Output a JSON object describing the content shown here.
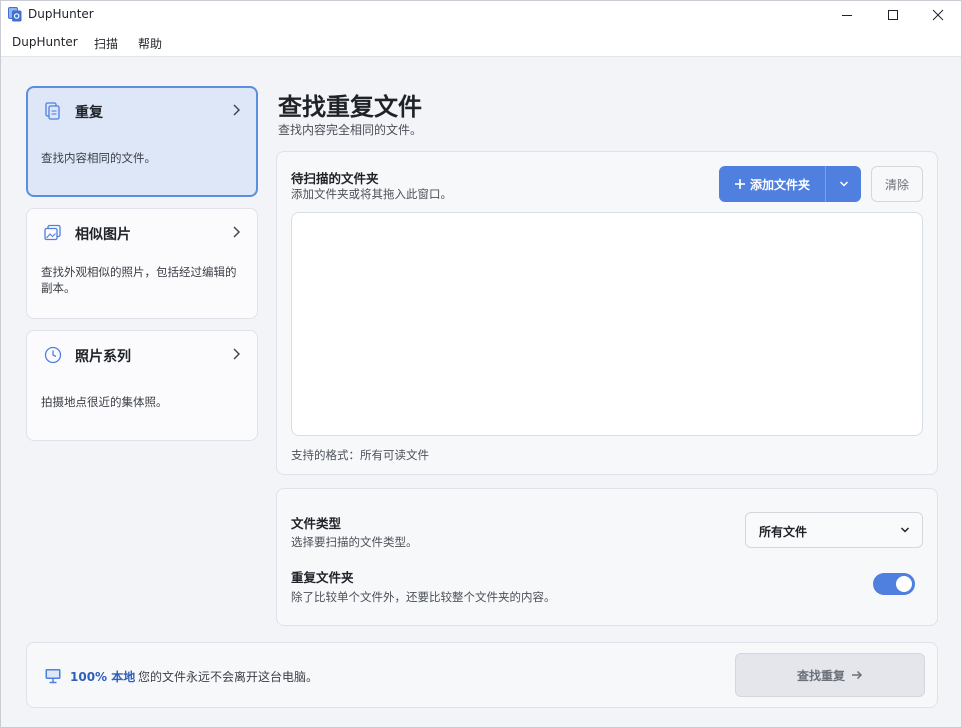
{
  "window": {
    "title": "DupHunter",
    "controls": [
      "minimize",
      "maximize",
      "close"
    ]
  },
  "menu": {
    "items": [
      {
        "label": "DupHunter"
      },
      {
        "label": "扫描"
      },
      {
        "label": "帮助"
      }
    ]
  },
  "sidebar": {
    "items": [
      {
        "title": "重复",
        "description": "查找内容相同的文件。",
        "icon": "document-copy-icon",
        "active": true
      },
      {
        "title": "相似图片",
        "description": "查找外观相似的照片，包括经过编辑的副本。",
        "icon": "photo-stack-icon",
        "active": false
      },
      {
        "title": "照片系列",
        "description": "拍摄地点很近的集体照。",
        "icon": "clock-icon",
        "active": false
      }
    ]
  },
  "main": {
    "title": "查找重复文件",
    "subtitle": "查找内容完全相同的文件。"
  },
  "folders": {
    "label": "待扫描的文件夹",
    "hint": "添加文件夹或将其拖入此窗口。",
    "add_label": "添加文件夹",
    "clear_label": "清除",
    "supported_formats": "支持的格式：所有可读文件"
  },
  "options": {
    "file_type_label": "文件类型",
    "file_type_hint": "选择要扫描的文件类型。",
    "file_type_value": "所有文件",
    "dup_folders_label": "重复文件夹",
    "dup_folders_hint": "除了比较单个文件外，还要比较整个文件夹的内容。",
    "dup_folders_enabled": true
  },
  "footer": {
    "local_label": "100% 本地",
    "local_text": "您的文件永远不会离开这台电脑。",
    "find_label": "查找重复"
  },
  "colors": {
    "accent": "#4f7fdf",
    "active_card_bg": "#dde7f7",
    "active_card_border": "#5b8fde"
  }
}
